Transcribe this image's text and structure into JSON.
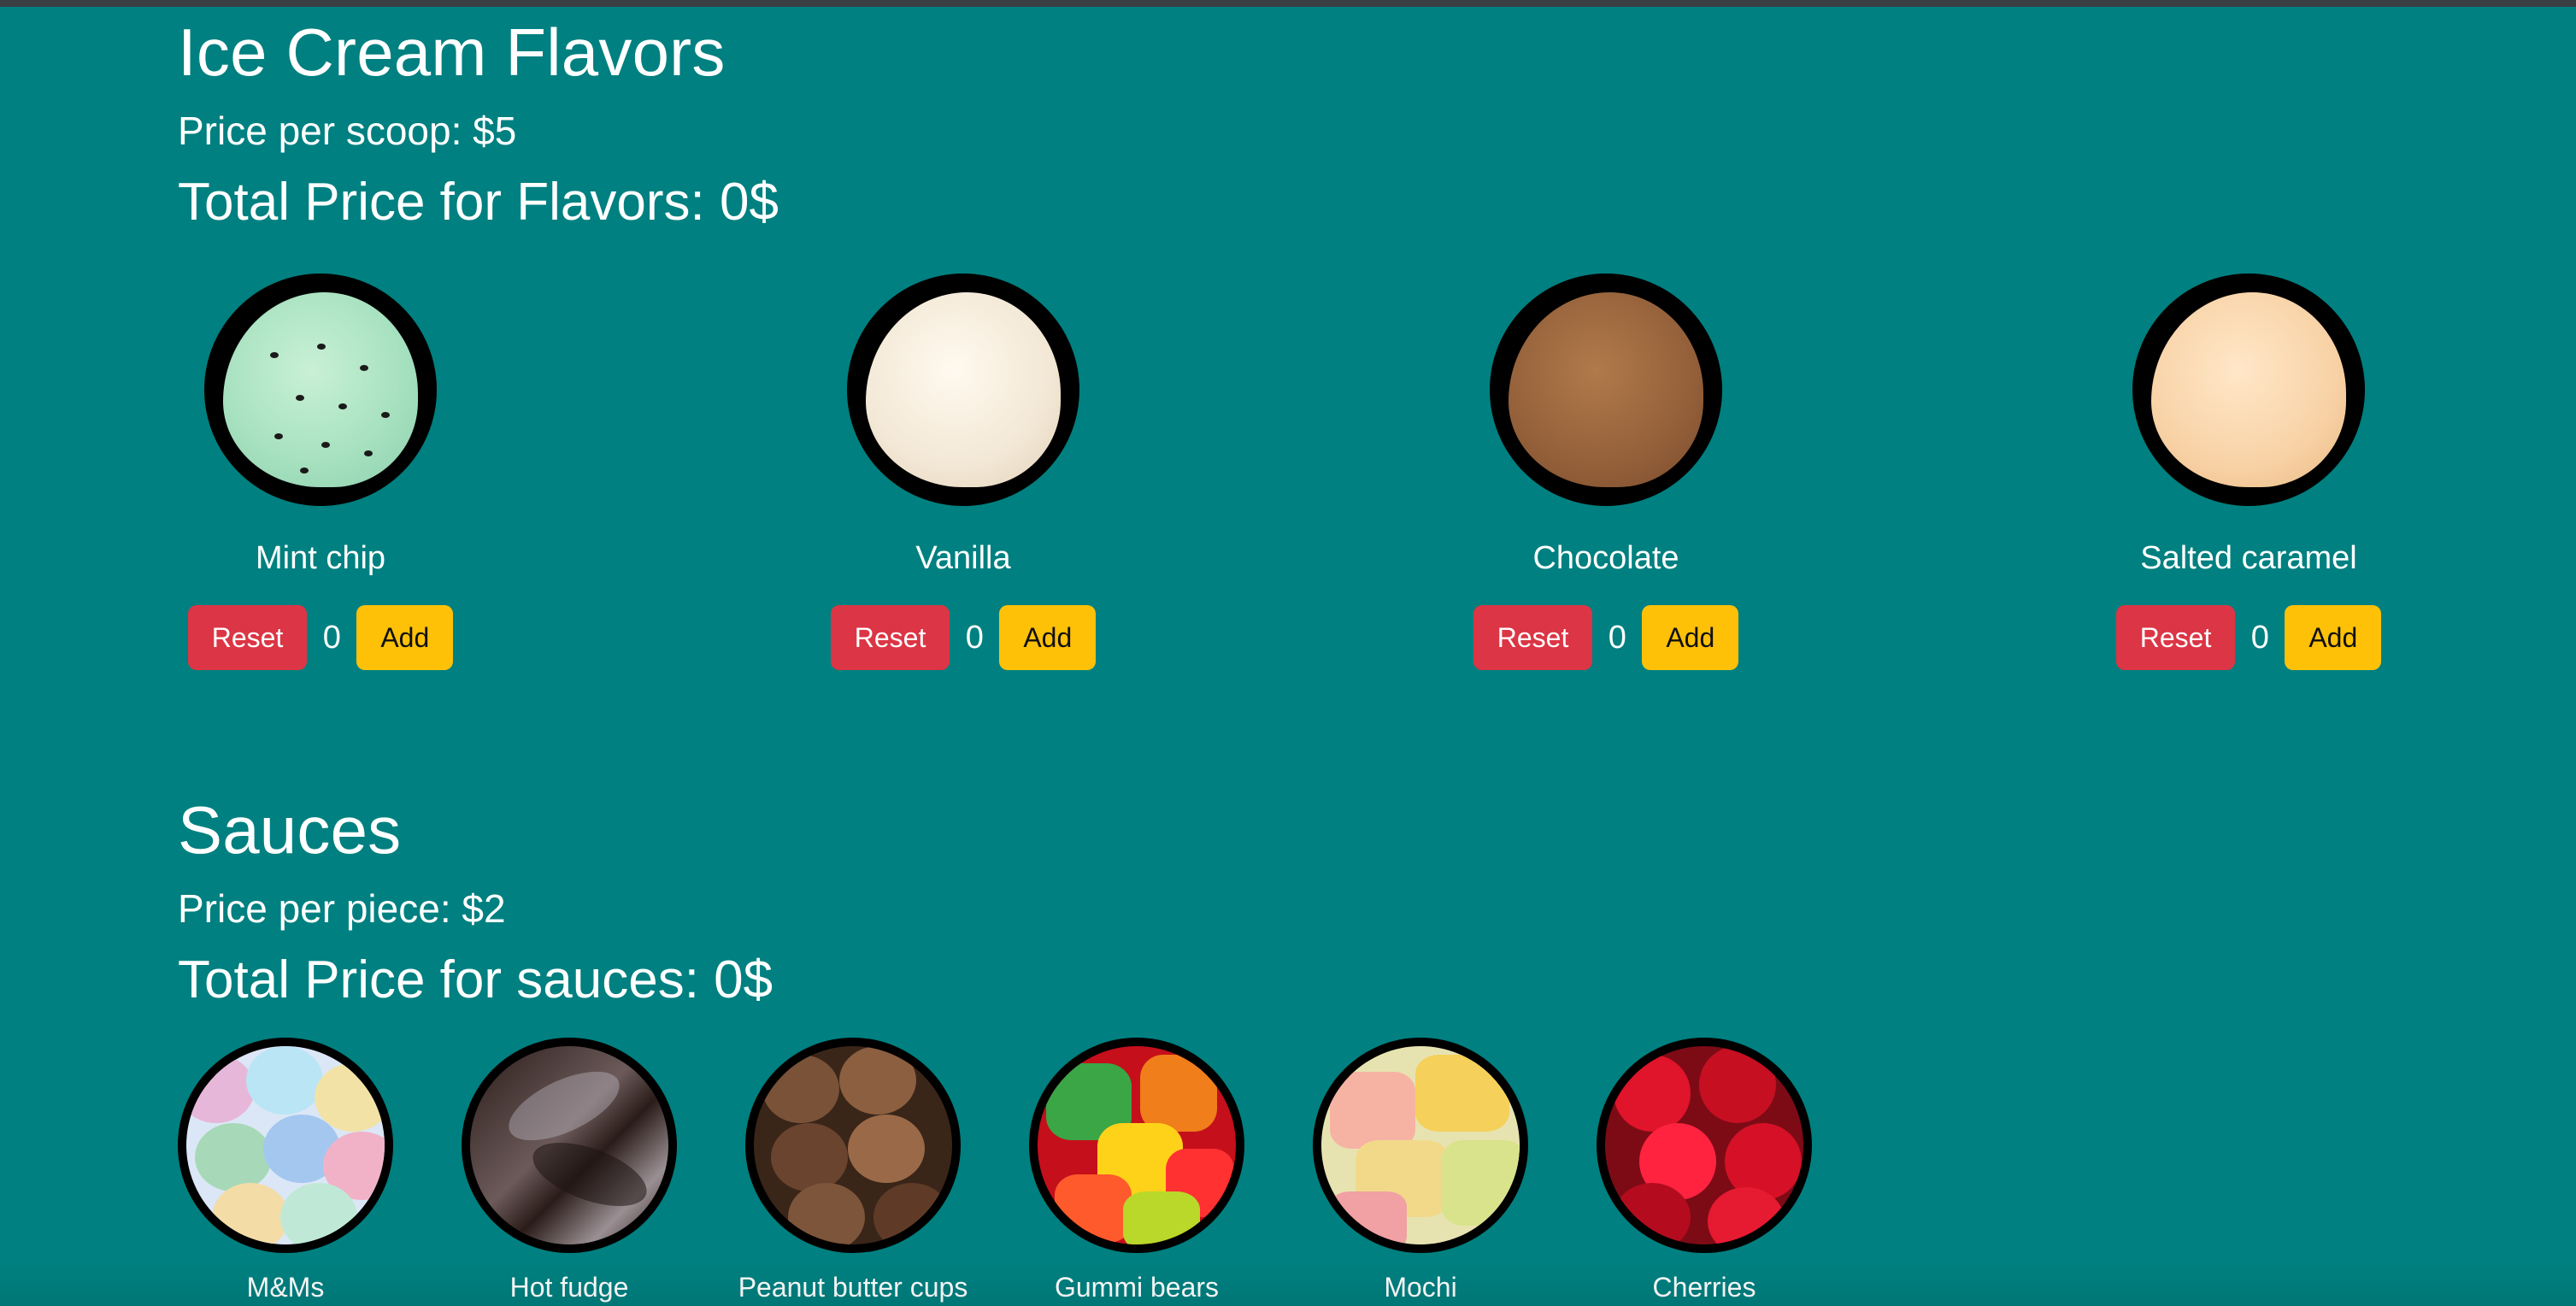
{
  "flavors_section": {
    "title": "Ice Cream Flavors",
    "price_text": "Price per scoop: $5",
    "total_text": "Total Price for Flavors: 0$",
    "items": [
      {
        "label": "Mint chip",
        "count": "0"
      },
      {
        "label": "Vanilla",
        "count": "0"
      },
      {
        "label": "Chocolate",
        "count": "0"
      },
      {
        "label": "Salted caramel",
        "count": "0"
      }
    ],
    "buttons": {
      "reset": "Reset",
      "add": "Add"
    }
  },
  "sauces_section": {
    "title": "Sauces",
    "price_text": "Price per piece: $2",
    "total_text": "Total Price for sauces: 0$",
    "items": [
      {
        "label": "M&Ms"
      },
      {
        "label": "Hot fudge"
      },
      {
        "label": "Peanut butter cups"
      },
      {
        "label": "Gummi bears"
      },
      {
        "label": "Mochi"
      },
      {
        "label": "Cherries"
      }
    ]
  },
  "colors": {
    "background": "#008080",
    "reset": "#dc3545",
    "add": "#ffc107"
  }
}
